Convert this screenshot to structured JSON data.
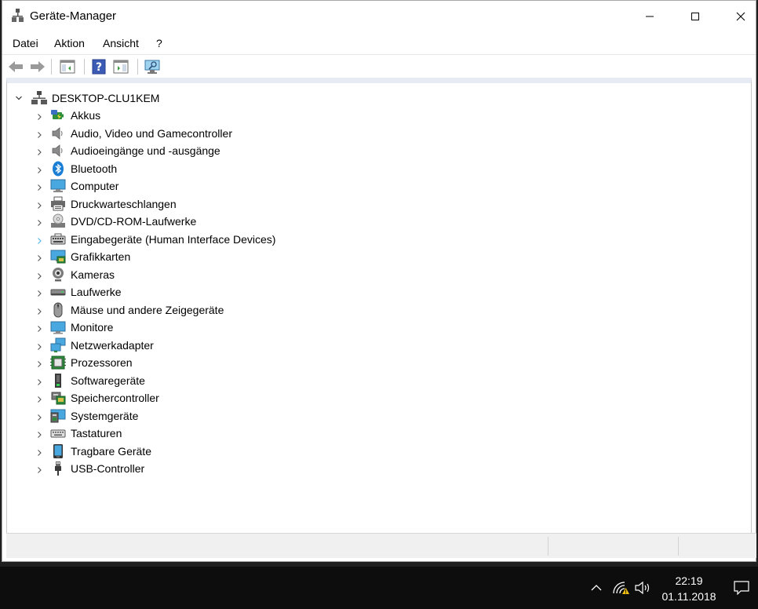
{
  "window": {
    "title": "Geräte-Manager"
  },
  "menu": [
    "Datei",
    "Aktion",
    "Ansicht",
    "?"
  ],
  "toolbar_icons": [
    "back-arrow-icon",
    "forward-arrow-icon",
    "show-hide-console-tree-icon",
    "help-icon",
    "properties-pane-icon",
    "scan-hardware-monitor-icon"
  ],
  "tree": {
    "root": "DESKTOP-CLU1KEM",
    "categories": [
      {
        "label": "Akkus",
        "icon": "battery-icon"
      },
      {
        "label": "Audio, Video und Gamecontroller",
        "icon": "speaker-icon"
      },
      {
        "label": "Audioeingänge und -ausgänge",
        "icon": "speaker-icon"
      },
      {
        "label": "Bluetooth",
        "icon": "bluetooth-icon"
      },
      {
        "label": "Computer",
        "icon": "computer-icon"
      },
      {
        "label": "Druckwarteschlangen",
        "icon": "printer-icon"
      },
      {
        "label": "DVD/CD-ROM-Laufwerke",
        "icon": "dvd-drive-icon"
      },
      {
        "label": "Eingabegeräte (Human Interface Devices)",
        "icon": "hid-icon"
      },
      {
        "label": "Grafikkarten",
        "icon": "display-adapter-icon"
      },
      {
        "label": "Kameras",
        "icon": "camera-icon"
      },
      {
        "label": "Laufwerke",
        "icon": "disk-drive-icon"
      },
      {
        "label": "Mäuse und andere Zeigegeräte",
        "icon": "mouse-icon"
      },
      {
        "label": "Monitore",
        "icon": "monitor-icon"
      },
      {
        "label": "Netzwerkadapter",
        "icon": "network-adapter-icon"
      },
      {
        "label": "Prozessoren",
        "icon": "processor-icon"
      },
      {
        "label": "Softwaregeräte",
        "icon": "software-device-icon"
      },
      {
        "label": "Speichercontroller",
        "icon": "storage-controller-icon"
      },
      {
        "label": "Systemgeräte",
        "icon": "system-device-icon"
      },
      {
        "label": "Tastaturen",
        "icon": "keyboard-icon"
      },
      {
        "label": "Tragbare Geräte",
        "icon": "portable-device-icon"
      },
      {
        "label": "USB-Controller",
        "icon": "usb-icon"
      }
    ]
  },
  "taskbar": {
    "time": "22:19",
    "date": "01.11.2018"
  }
}
